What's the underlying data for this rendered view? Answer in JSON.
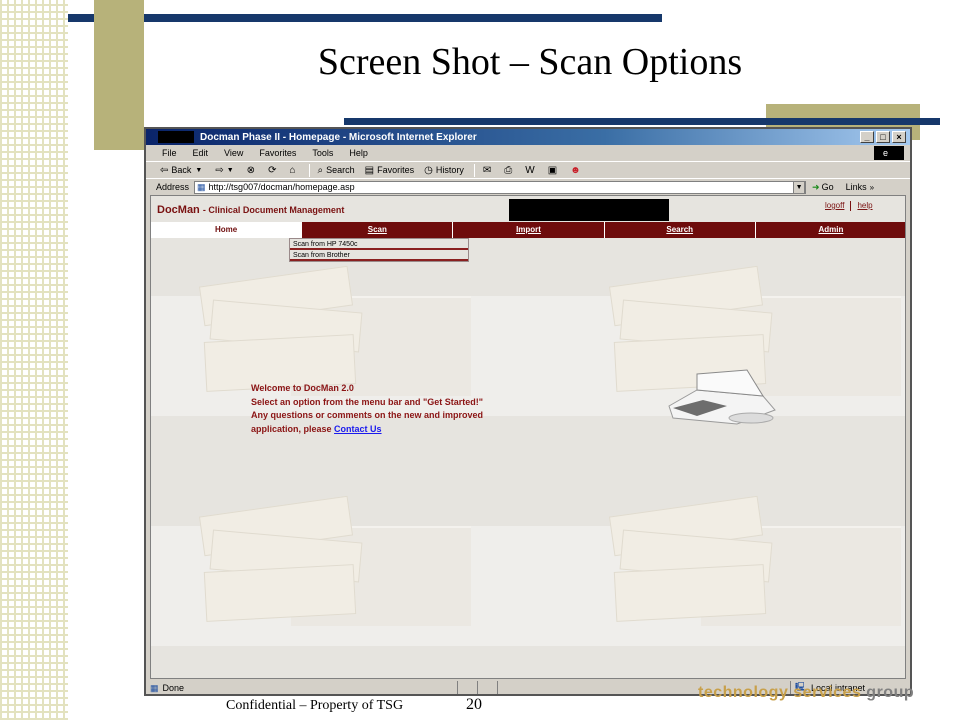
{
  "slide": {
    "title": "Screen Shot – Scan Options",
    "footer": "Confidential – Property of TSG",
    "page_number": "20",
    "logo_main": "technology services",
    "logo_end": "group"
  },
  "browser": {
    "window_title": "Docman Phase II - Homepage - Microsoft Internet Explorer",
    "menu": [
      "File",
      "Edit",
      "View",
      "Favorites",
      "Tools",
      "Help"
    ],
    "toolbar": {
      "back": "Back",
      "search": "Search",
      "favorites": "Favorites",
      "history": "History"
    },
    "address_label": "Address",
    "address_url": "http://tsg007/docman/homepage.asp",
    "go_label": "Go",
    "links_label": "Links",
    "status_text": "Done",
    "zone_text": "Local intranet"
  },
  "app": {
    "name": "DocMan",
    "subtitle": "- Clinical Document Management",
    "top_links": [
      "logoff",
      "help"
    ],
    "nav": [
      "Home",
      "Scan",
      "Import",
      "Search",
      "Admin"
    ],
    "active_nav": "Home",
    "scan_menu": [
      "Scan from HP 7450c",
      "Scan from Brother"
    ],
    "welcome": {
      "line1": "Welcome to DocMan 2.0",
      "line2": "Select an option from the menu bar and \"Get Started!\"",
      "line3": "Any questions or comments on the new and improved",
      "line4_prefix": "application, please",
      "contact_link": "Contact Us"
    }
  },
  "colors": {
    "brand_red": "#6e0c0c",
    "slide_navy": "#16386b",
    "slide_olive": "#b7b27a"
  }
}
